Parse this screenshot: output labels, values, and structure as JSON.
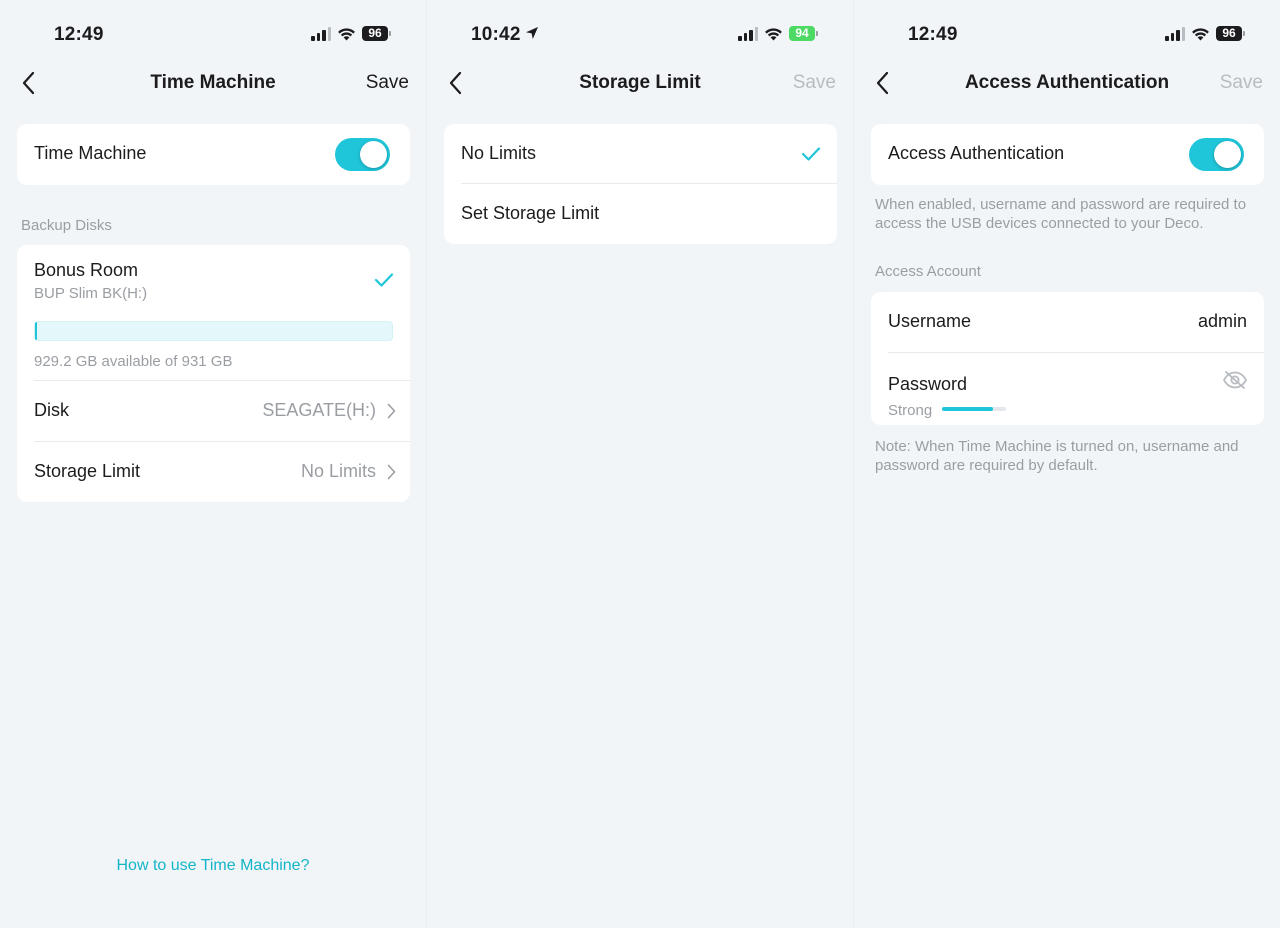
{
  "colors": {
    "accent": "#1fc5d9",
    "link": "#14b5c9",
    "secondary_text": "#9a9ea3",
    "battery_charging": "#4cd964"
  },
  "screen1": {
    "status": {
      "time": "12:49",
      "battery": "96"
    },
    "nav": {
      "title": "Time Machine",
      "save": "Save"
    },
    "time_machine_toggle": {
      "label": "Time Machine",
      "on": true
    },
    "backup_disks_header": "Backup Disks",
    "disk": {
      "name": "Bonus Room",
      "device": "BUP Slim BK(H:)",
      "used_fraction": 0.002,
      "capacity": "929.2 GB available of 931 GB"
    },
    "disk_row": {
      "label": "Disk",
      "value": "SEAGATE(H:)"
    },
    "storage_row": {
      "label": "Storage Limit",
      "value": "No Limits"
    },
    "help_link": "How to use Time Machine?"
  },
  "screen2": {
    "status": {
      "time": "10:42",
      "battery": "94"
    },
    "nav": {
      "title": "Storage Limit",
      "save": "Save"
    },
    "options": [
      {
        "label": "No Limits",
        "selected": true
      },
      {
        "label": "Set Storage Limit",
        "selected": false
      }
    ]
  },
  "screen3": {
    "status": {
      "time": "12:49",
      "battery": "96"
    },
    "nav": {
      "title": "Access Authentication",
      "save": "Save"
    },
    "auth_toggle": {
      "label": "Access Authentication",
      "on": true
    },
    "auth_description": "When enabled, username and password are required to access the USB devices connected to your Deco.",
    "account_header": "Access Account",
    "username": {
      "label": "Username",
      "value": "admin"
    },
    "password": {
      "label": "Password",
      "strength": "Strong",
      "strength_fraction": 0.8
    },
    "note": "Note: When Time Machine is turned on, username and password are required by default."
  }
}
